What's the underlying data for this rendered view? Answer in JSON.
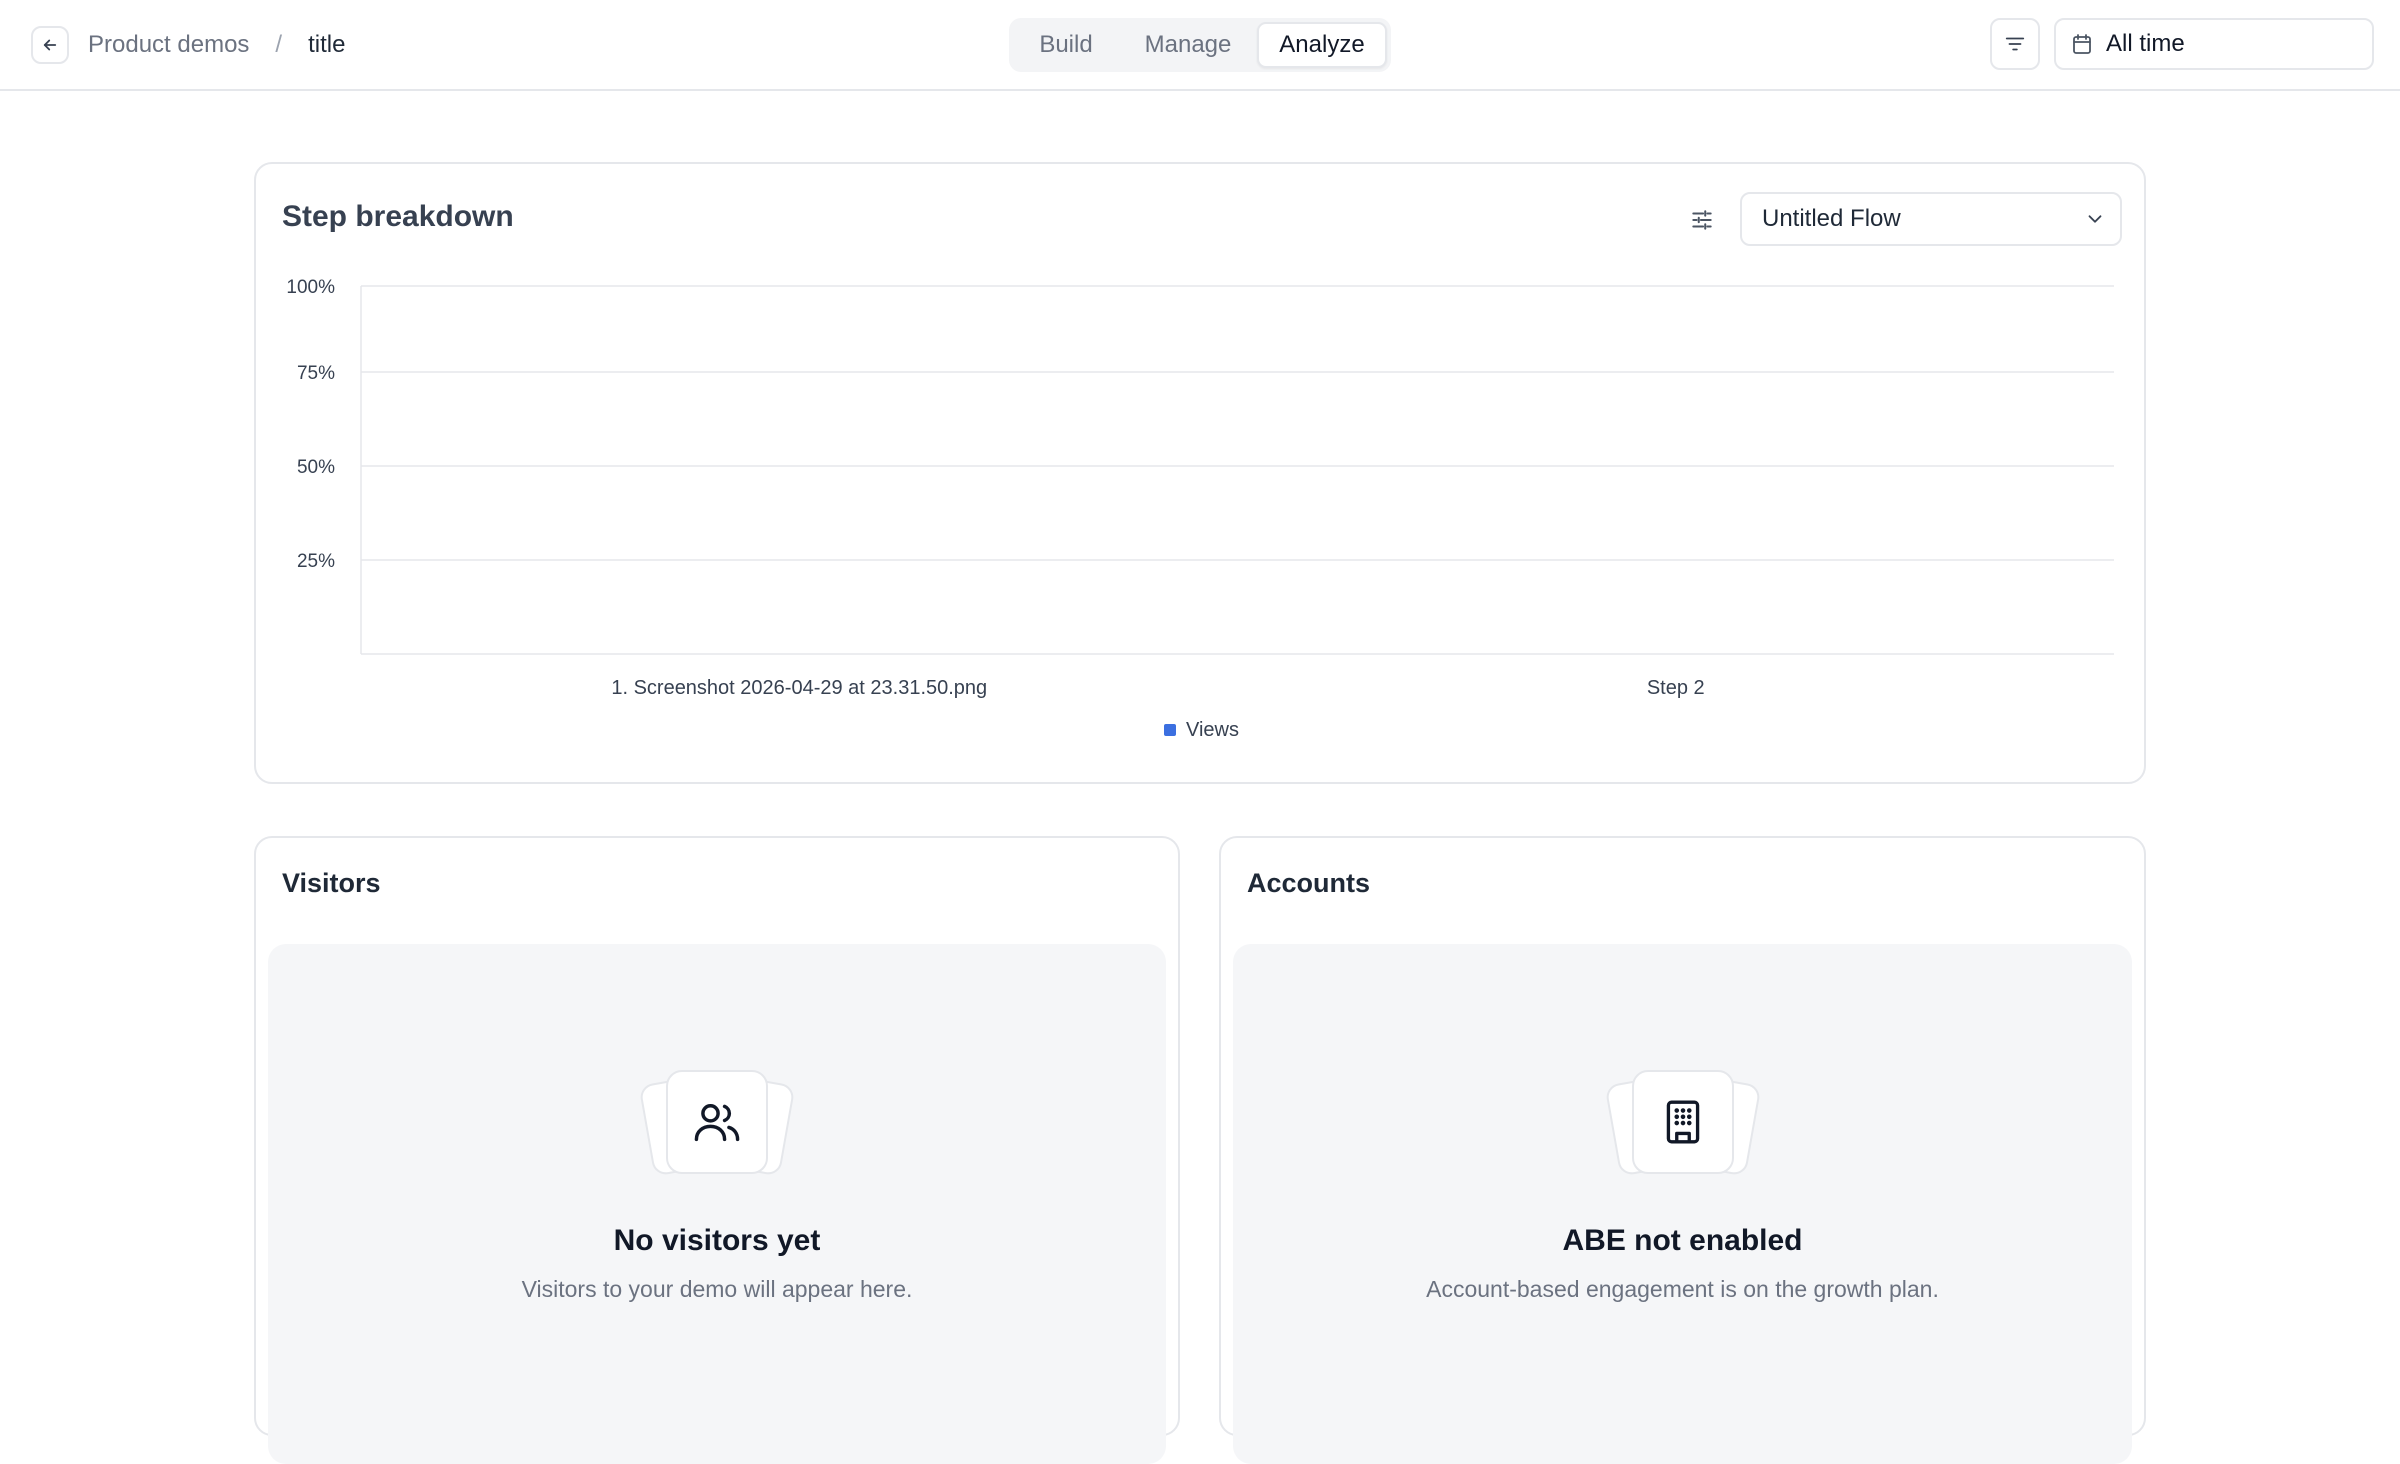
{
  "header": {
    "breadcrumb_parent": "Product demos",
    "breadcrumb_separator": "/",
    "breadcrumb_current": "title",
    "tabs": [
      {
        "label": "Build",
        "active": false
      },
      {
        "label": "Manage",
        "active": false
      },
      {
        "label": "Analyze",
        "active": true
      }
    ],
    "date_range": "All time",
    "icons": {
      "back": "arrow-left-icon",
      "filter": "filter-lines-icon",
      "date": "calendar-icon"
    }
  },
  "breakdown": {
    "title": "Step breakdown",
    "flow_select": "Untitled Flow",
    "icons": {
      "settings": "sliders-icon",
      "dropdown": "chevron-down-icon"
    }
  },
  "chart_data": {
    "type": "bar",
    "categories": [
      "1. Screenshot 2026-04-29 at 23.31.50.png",
      "Step 2"
    ],
    "series": [
      {
        "name": "Views",
        "values": [
          0,
          0
        ],
        "color": "#3b6fe0"
      }
    ],
    "y_ticks": [
      "100%",
      "75%",
      "50%",
      "25%"
    ],
    "ylim": [
      0,
      100
    ],
    "legend": [
      "Views"
    ],
    "legend_position": "bottom",
    "grid": true
  },
  "visitors": {
    "title": "Visitors",
    "empty_heading": "No visitors yet",
    "empty_text": "Visitors to your demo will appear here.",
    "icon": "users-icon"
  },
  "accounts": {
    "title": "Accounts",
    "empty_heading": "ABE not enabled",
    "empty_text": "Account-based engagement is on the growth plan.",
    "icon": "building-icon"
  },
  "colors": {
    "border": "#e5e7eb",
    "muted_text": "#6b7280",
    "series_views": "#3b6fe0",
    "empty_bg": "#f5f6f8"
  }
}
